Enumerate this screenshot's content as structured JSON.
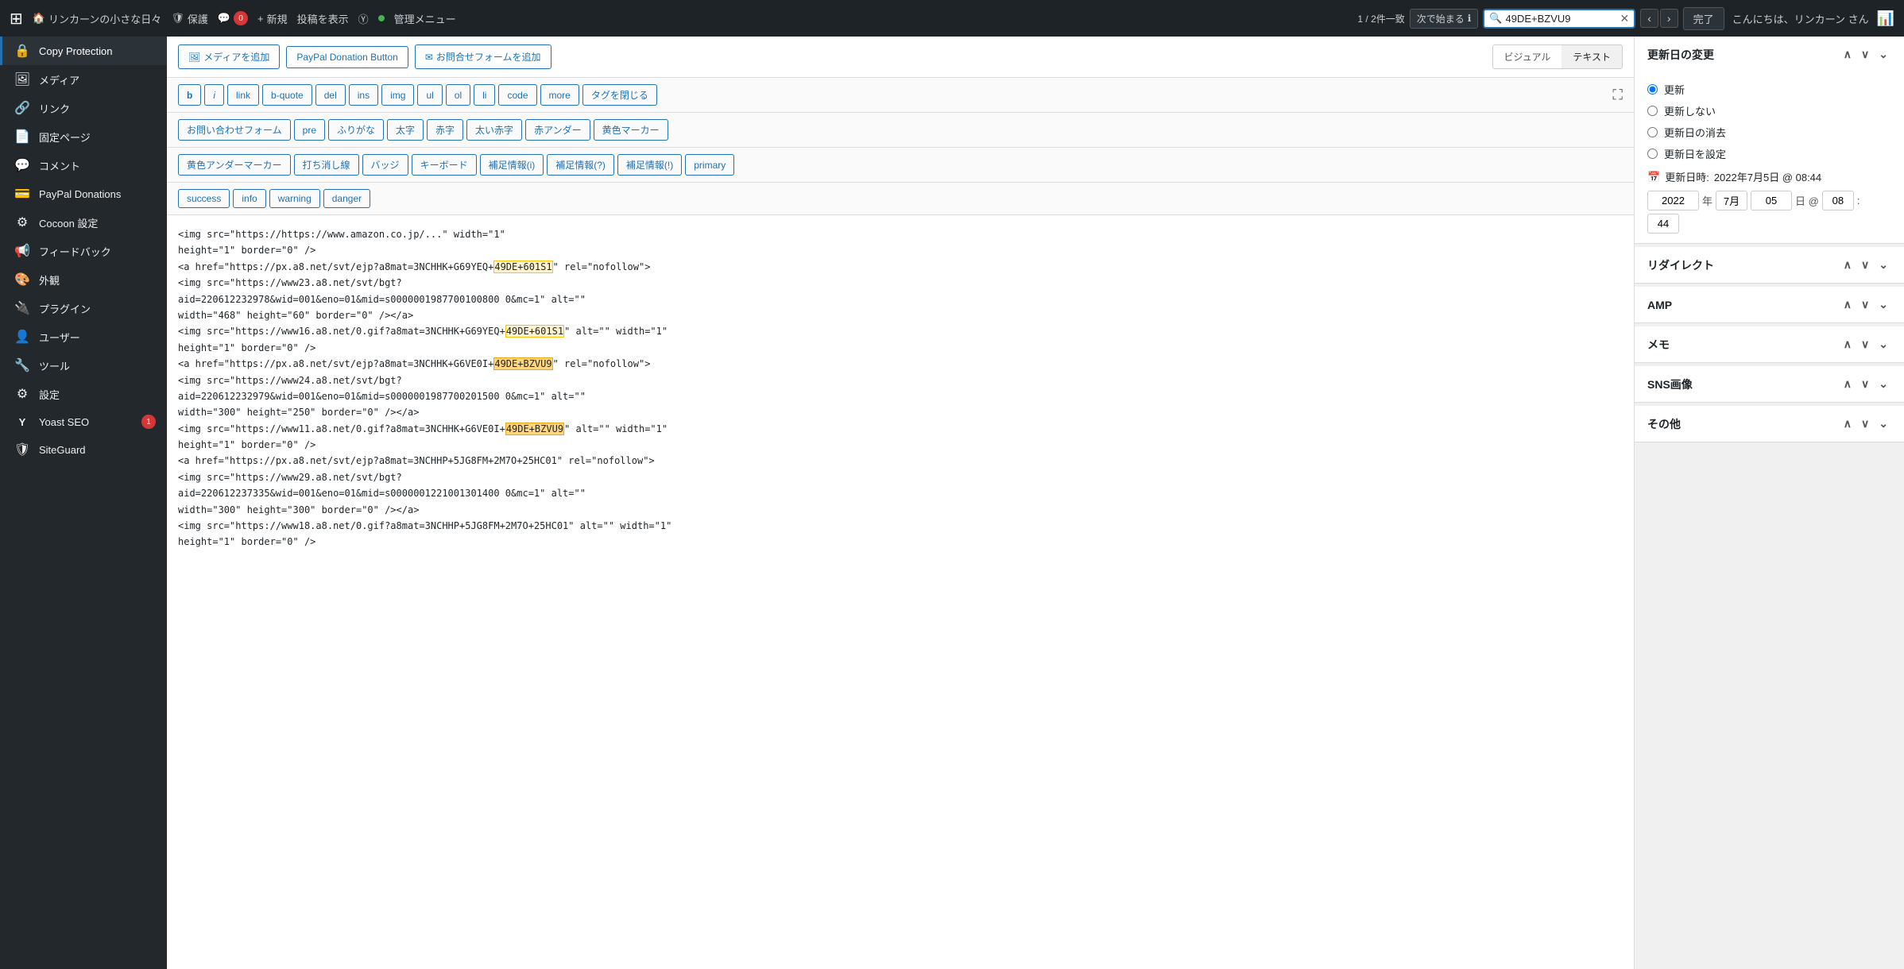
{
  "adminbar": {
    "wp_logo": "⊞",
    "site_icon": "🏠",
    "site_name": "リンカーンの小さな日々",
    "protect_icon": "🛡",
    "protect_label": "保護",
    "comment_icon": "💬",
    "comment_count": "0",
    "new_icon": "+",
    "new_label": "新規",
    "view_label": "投稿を表示",
    "settings_label": "管理メニュー",
    "greeting": "こんにちは、リンカーン さん",
    "search_match": "1 / 2件一致",
    "search_next_label": "次で始まる",
    "search_value": "49DE+BZVU9",
    "done_label": "完了"
  },
  "sidebar": {
    "items": [
      {
        "id": "copy-protection",
        "icon": "🔒",
        "label": "Copy Protection",
        "active": true
      },
      {
        "id": "media",
        "icon": "🖼",
        "label": "メディア",
        "active": false
      },
      {
        "id": "link",
        "icon": "🔗",
        "label": "リンク",
        "active": false
      },
      {
        "id": "fixed-page",
        "icon": "📄",
        "label": "固定ページ",
        "active": false
      },
      {
        "id": "comment",
        "icon": "💬",
        "label": "コメント",
        "active": false
      },
      {
        "id": "paypal",
        "icon": "💳",
        "label": "PayPal Donations",
        "active": false
      },
      {
        "id": "cocoon",
        "icon": "⚙",
        "label": "Cocoon 設定",
        "active": false
      },
      {
        "id": "feedback",
        "icon": "📢",
        "label": "フィードバック",
        "active": false
      },
      {
        "id": "appearance",
        "icon": "🎨",
        "label": "外観",
        "active": false
      },
      {
        "id": "plugins",
        "icon": "🔌",
        "label": "プラグイン",
        "active": false
      },
      {
        "id": "users",
        "icon": "👤",
        "label": "ユーザー",
        "active": false
      },
      {
        "id": "tools",
        "icon": "🔧",
        "label": "ツール",
        "active": false
      },
      {
        "id": "settings",
        "icon": "⚙",
        "label": "設定",
        "active": false
      },
      {
        "id": "yoast",
        "icon": "Y",
        "label": "Yoast SEO",
        "badge": "1",
        "active": false
      },
      {
        "id": "siteguard",
        "icon": "🛡",
        "label": "SiteGuard",
        "active": false
      }
    ]
  },
  "toolbar": {
    "media_btn": "メディアを追加",
    "paypal_btn": "PayPal Donation Button",
    "contact_btn": "お問合せフォームを追加",
    "visual_label": "ビジュアル",
    "text_label": "テキスト",
    "fmt_buttons": [
      "b",
      "i",
      "link",
      "b-quote",
      "del",
      "ins",
      "img",
      "ul",
      "ol",
      "li",
      "code",
      "more",
      "タグを閉じる"
    ],
    "row2_buttons": [
      "お問い合わせフォーム",
      "pre",
      "ふりがな",
      "太字",
      "赤字",
      "太い赤字",
      "赤アンダー",
      "黄色マーカー"
    ],
    "row3_buttons": [
      "黄色アンダーマーカー",
      "打ち消し線",
      "バッジ",
      "キーボード",
      "補足情報(i)",
      "補足情報(?)",
      "補足情報(!)",
      "primary"
    ],
    "row4_buttons": [
      "success",
      "info",
      "warning",
      "danger"
    ]
  },
  "editor": {
    "content": "<img src=\"https://https://www.amazon.co.jp/...\" width=\"1\"\nheight=\"1\" border=\"0\" />\n<a href=\"https://px.a8.net/svt/ejp?a8mat=3NCHHK+G69YEQ+49DE+601S1\" rel=\"nofollow\">\n<img src=\"https://www23.a8.net/svt/bgt?\naid=220612232978&amp;wid=001&amp;eno=01&amp;mid=s0000001987700100800 0&amp;mc=1\" alt=\"\"\nwidth=\"468\" height=\"60\" border=\"0\" /></a>\n<img src=\"https://www16.a8.net/0.gif?a8mat=3NCHHK+G69YEQ+49DE+601S1\" alt=\"\" width=\"1\"\nheight=\"1\" border=\"0\" />\n<a href=\"https://px.a8.net/svt/ejp?a8mat=3NCHHK+G6VE0I+49DE+BZVU9\" rel=\"nofollow\">\n<img src=\"https://www24.a8.net/svt/bgt?\naid=220612232979&amp;wid=001&amp;eno=01&amp;mid=s0000001987700201500 0&amp;mc=1\" alt=\"\"\nwidth=\"300\" height=\"250\" border=\"0\" /></a>\n<img src=\"https://www11.a8.net/0.gif?a8mat=3NCHHK+G6VE0I+49DE+BZVU9\" alt=\"\" width=\"1\"\nheight=\"1\" border=\"0\" />\n<a href=\"https://px.a8.net/svt/ejp?a8mat=3NCHHP+5JG8FM+2M7O+25HC01\" rel=\"nofollow\">\n<img src=\"https://www29.a8.net/svt/bgt?\naid=220612237335&amp;wid=001&amp;eno=01&amp;mid=s0000001221001301400 0&amp;mc=1\" alt=\"\"\nwidth=\"300\" height=\"300\" border=\"0\" /></a>\n<img src=\"https://www18.a8.net/0.gif?a8mat=3NCHHP+5JG8FM+2M7O+25HC01\" alt=\"\" width=\"1\"\nheight=\"1\" border=\"0\" />"
  },
  "right_sidebar": {
    "update_section": {
      "title": "更新日の変更",
      "radio_options": [
        {
          "id": "update",
          "label": "更新",
          "checked": true
        },
        {
          "id": "no-update",
          "label": "更新しない",
          "checked": false
        },
        {
          "id": "delete-update",
          "label": "更新日の消去",
          "checked": false
        },
        {
          "id": "set-update",
          "label": "更新日を設定",
          "checked": false
        }
      ],
      "date_label": "更新日時:",
      "date_value": "2022年7月5日 @ 08:44",
      "year": "2022",
      "month": "7月",
      "day": "05",
      "hour": "08",
      "minute": "44"
    },
    "redirect_section": {
      "title": "リダイレクト"
    },
    "amp_section": {
      "title": "AMP"
    },
    "memo_section": {
      "title": "メモ"
    },
    "sns_section": {
      "title": "SNS画像"
    },
    "other_section": {
      "title": "その他"
    }
  }
}
